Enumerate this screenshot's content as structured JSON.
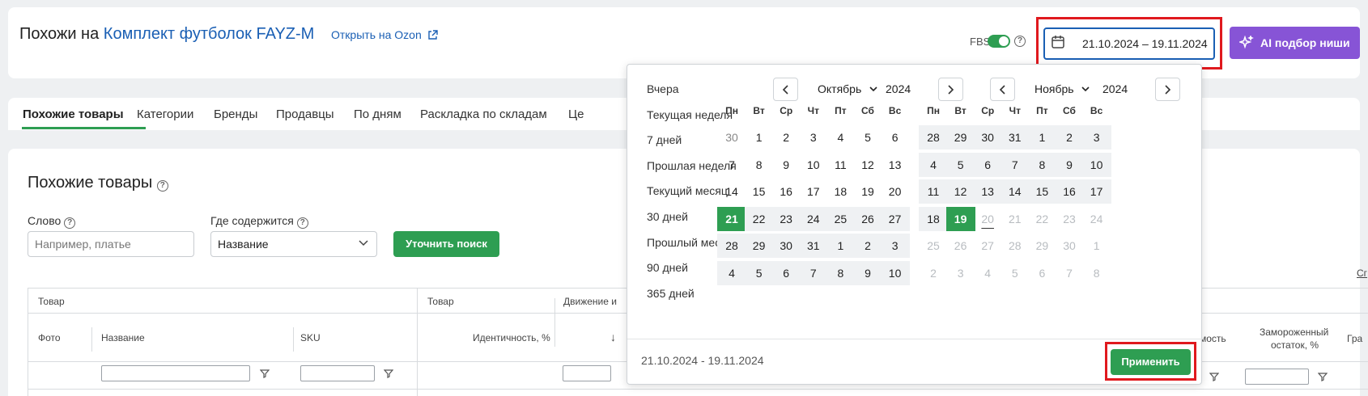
{
  "header": {
    "title_prefix": "Похожи на",
    "product_name": "Комплект футболок FAYZ-M",
    "open_link": "Открыть на Ozon",
    "fbs_label": "FBS",
    "fbs_enabled": true,
    "date_range": "21.10.2024 – 19.11.2024",
    "ai_button": "AI подбор ниши"
  },
  "tabs": [
    {
      "label": "Похожие товары",
      "active": true
    },
    {
      "label": "Категории"
    },
    {
      "label": "Бренды"
    },
    {
      "label": "Продавцы"
    },
    {
      "label": "По дням"
    },
    {
      "label": "Раскладка по складам"
    },
    {
      "label": "Це"
    }
  ],
  "section": {
    "title": "Похожие товары",
    "word_label": "Слово",
    "word_placeholder": "Например, платье",
    "where_label": "Где содержится",
    "where_value": "Название",
    "refine_button": "Уточнить поиск"
  },
  "table": {
    "group_headers": [
      "Товар",
      "Товар",
      "Движение и"
    ],
    "columns": [
      "Фото",
      "Название",
      "SKU",
      "Идентичность, %",
      "↓"
    ],
    "right_columns": [
      "мость",
      "Замороженный",
      "остаток, %",
      "Гра"
    ],
    "edge_text": "Сг"
  },
  "picker": {
    "presets": [
      "Вчера",
      "Текущая неделя",
      "7 дней",
      "Прошлая неделя",
      "Текущий месяц",
      "30 дней",
      "Прошлый месяц",
      "90 дней",
      "365 дней"
    ],
    "weekdays": [
      "Пн",
      "Вт",
      "Ср",
      "Чт",
      "Пт",
      "Сб",
      "Вс"
    ],
    "left": {
      "month": "Октябрь",
      "year": "2024",
      "days": [
        [
          "30",
          "1",
          "2",
          "3",
          "4",
          "5",
          "6"
        ],
        [
          "7",
          "8",
          "9",
          "10",
          "11",
          "12",
          "13"
        ],
        [
          "14",
          "15",
          "16",
          "17",
          "18",
          "19",
          "20"
        ],
        [
          "21",
          "22",
          "23",
          "24",
          "25",
          "26",
          "27"
        ],
        [
          "28",
          "29",
          "30",
          "31",
          "1",
          "2",
          "3"
        ],
        [
          "4",
          "5",
          "6",
          "7",
          "8",
          "9",
          "10"
        ]
      ]
    },
    "right": {
      "month": "Ноябрь",
      "year": "2024",
      "days": [
        [
          "28",
          "29",
          "30",
          "31",
          "1",
          "2",
          "3"
        ],
        [
          "4",
          "5",
          "6",
          "7",
          "8",
          "9",
          "10"
        ],
        [
          "11",
          "12",
          "13",
          "14",
          "15",
          "16",
          "17"
        ],
        [
          "18",
          "19",
          "20",
          "21",
          "22",
          "23",
          "24"
        ],
        [
          "25",
          "26",
          "27",
          "28",
          "29",
          "30",
          "1"
        ],
        [
          "2",
          "3",
          "4",
          "5",
          "6",
          "7",
          "8"
        ]
      ]
    },
    "selected_range": "21.10.2024 - 19.11.2024",
    "apply_button": "Применить"
  },
  "colors": {
    "accent_green": "#2e9e52",
    "link_blue": "#1a5fb4",
    "ai_purple": "#8754d6",
    "highlight_red": "#e0191e"
  }
}
